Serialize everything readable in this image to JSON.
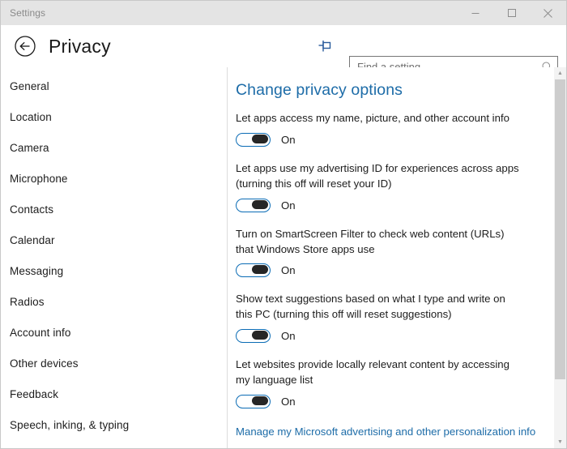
{
  "window": {
    "title": "Settings",
    "controls": [
      {
        "name": "minimize-button",
        "label": "—"
      },
      {
        "name": "maximize-button",
        "label": "□"
      },
      {
        "name": "close-button",
        "label": "✕"
      }
    ]
  },
  "header": {
    "back_label": "←",
    "page_title": "Privacy",
    "pin_label": "pin",
    "search": {
      "placeholder": "Find a setting",
      "value": ""
    }
  },
  "sidebar": {
    "items": [
      {
        "label": "General"
      },
      {
        "label": "Location"
      },
      {
        "label": "Camera"
      },
      {
        "label": "Microphone"
      },
      {
        "label": "Contacts"
      },
      {
        "label": "Calendar"
      },
      {
        "label": "Messaging"
      },
      {
        "label": "Radios"
      },
      {
        "label": "Account info"
      },
      {
        "label": "Other devices"
      },
      {
        "label": "Feedback"
      },
      {
        "label": "Speech, inking, & typing"
      }
    ]
  },
  "main": {
    "heading": "Change privacy options",
    "settings": [
      {
        "label": "Let apps access my name, picture, and other account info",
        "state": "On"
      },
      {
        "label": "Let apps use my advertising ID for experiences across apps (turning this off will reset your ID)",
        "state": "On"
      },
      {
        "label": "Turn on SmartScreen Filter to check web content (URLs) that Windows Store apps use",
        "state": "On"
      },
      {
        "label": "Show text suggestions based on what I type and write on this PC (turning this off will reset suggestions)",
        "state": "On"
      },
      {
        "label": "Let websites provide locally relevant content by accessing my language list",
        "state": "On"
      }
    ],
    "link": "Manage my Microsoft advertising and other personalization info"
  },
  "scrollbar": {
    "up_arrow": "▲",
    "down_arrow": "▼"
  },
  "colors": {
    "accent_blue": "#1d6ca8",
    "toggle_border": "#0b6cb5",
    "toggle_knob": "#262626",
    "titlebar_bg": "#e4e4e4"
  }
}
